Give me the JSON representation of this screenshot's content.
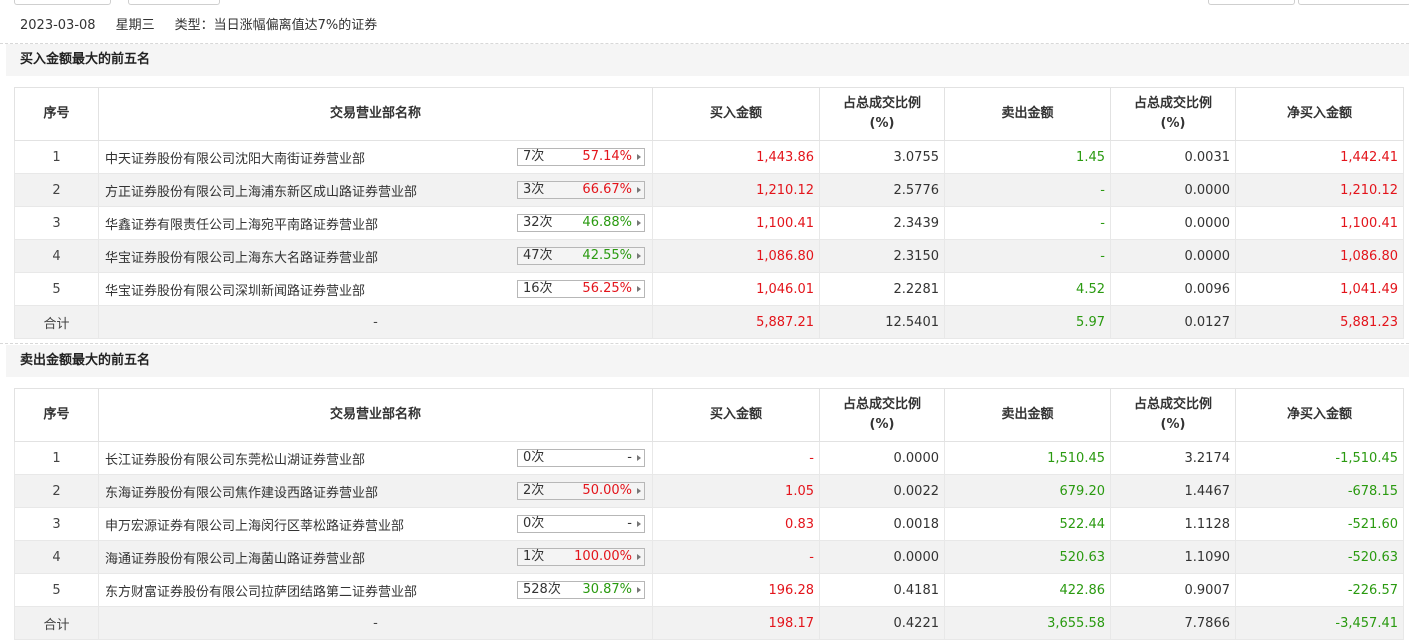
{
  "info": {
    "date": "2023-03-08",
    "weekday": "星期三",
    "type": "类型：当日涨幅偏离值达7%的证券"
  },
  "colors": {
    "up": "#e3141b",
    "down": "#2a9a10"
  },
  "headers": {
    "seq": "序号",
    "name": "交易营业部名称",
    "buy": "买入金额",
    "buy_ratio_1": "占总成交比例",
    "buy_ratio_2": "(%)",
    "sell": "卖出金额",
    "sell_ratio_1": "占总成交比例",
    "sell_ratio_2": "(%)",
    "net": "净买入金额"
  },
  "buy_section": {
    "title": "买入金额最大的前五名",
    "rows": [
      {
        "seq": "1",
        "name": "中天证券股份有限公司沈阳大南街证券营业部",
        "count": "7次",
        "pct": "57.14%",
        "pct_color": "red",
        "buy": "1,443.86",
        "buy_ratio": "3.0755",
        "sell": "1.45",
        "sell_ratio": "0.0031",
        "net": "1,442.41",
        "net_color": "red"
      },
      {
        "seq": "2",
        "name": "方正证券股份有限公司上海浦东新区成山路证券营业部",
        "count": "3次",
        "pct": "66.67%",
        "pct_color": "red",
        "buy": "1,210.12",
        "buy_ratio": "2.5776",
        "sell": "-",
        "sell_ratio": "0.0000",
        "net": "1,210.12",
        "net_color": "red"
      },
      {
        "seq": "3",
        "name": "华鑫证券有限责任公司上海宛平南路证券营业部",
        "count": "32次",
        "pct": "46.88%",
        "pct_color": "green",
        "buy": "1,100.41",
        "buy_ratio": "2.3439",
        "sell": "-",
        "sell_ratio": "0.0000",
        "net": "1,100.41",
        "net_color": "red"
      },
      {
        "seq": "4",
        "name": "华宝证券股份有限公司上海东大名路证券营业部",
        "count": "47次",
        "pct": "42.55%",
        "pct_color": "green",
        "buy": "1,086.80",
        "buy_ratio": "2.3150",
        "sell": "-",
        "sell_ratio": "0.0000",
        "net": "1,086.80",
        "net_color": "red"
      },
      {
        "seq": "5",
        "name": "华宝证券股份有限公司深圳新闻路证券营业部",
        "count": "16次",
        "pct": "56.25%",
        "pct_color": "red",
        "buy": "1,046.01",
        "buy_ratio": "2.2281",
        "sell": "4.52",
        "sell_ratio": "0.0096",
        "net": "1,041.49",
        "net_color": "red"
      }
    ],
    "total": {
      "label": "合计",
      "name": "-",
      "buy": "5,887.21",
      "buy_ratio": "12.5401",
      "sell": "5.97",
      "sell_ratio": "0.0127",
      "net": "5,881.23",
      "net_color": "red"
    }
  },
  "sell_section": {
    "title": "卖出金额最大的前五名",
    "rows": [
      {
        "seq": "1",
        "name": "长江证券股份有限公司东莞松山湖证券营业部",
        "count": "0次",
        "pct": "-",
        "pct_color": "dark",
        "buy": "-",
        "buy_ratio": "0.0000",
        "sell": "1,510.45",
        "sell_ratio": "3.2174",
        "net": "-1,510.45",
        "net_color": "green"
      },
      {
        "seq": "2",
        "name": "东海证券股份有限公司焦作建设西路证券营业部",
        "count": "2次",
        "pct": "50.00%",
        "pct_color": "red",
        "buy": "1.05",
        "buy_ratio": "0.0022",
        "sell": "679.20",
        "sell_ratio": "1.4467",
        "net": "-678.15",
        "net_color": "green"
      },
      {
        "seq": "3",
        "name": "申万宏源证券有限公司上海闵行区莘松路证券营业部",
        "count": "0次",
        "pct": "-",
        "pct_color": "dark",
        "buy": "0.83",
        "buy_ratio": "0.0018",
        "sell": "522.44",
        "sell_ratio": "1.1128",
        "net": "-521.60",
        "net_color": "green"
      },
      {
        "seq": "4",
        "name": "海通证券股份有限公司上海菌山路证券营业部",
        "count": "1次",
        "pct": "100.00%",
        "pct_color": "red",
        "buy": "-",
        "buy_ratio": "0.0000",
        "sell": "520.63",
        "sell_ratio": "1.1090",
        "net": "-520.63",
        "net_color": "green"
      },
      {
        "seq": "5",
        "name": "东方财富证券股份有限公司拉萨团结路第二证券营业部",
        "count": "528次",
        "pct": "30.87%",
        "pct_color": "green",
        "buy": "196.28",
        "buy_ratio": "0.4181",
        "sell": "422.86",
        "sell_ratio": "0.9007",
        "net": "-226.57",
        "net_color": "green"
      }
    ],
    "total": {
      "label": "合计",
      "name": "-",
      "buy": "198.17",
      "buy_ratio": "0.4221",
      "sell": "3,655.58",
      "sell_ratio": "7.7866",
      "net": "-3,457.41",
      "net_color": "green"
    }
  }
}
